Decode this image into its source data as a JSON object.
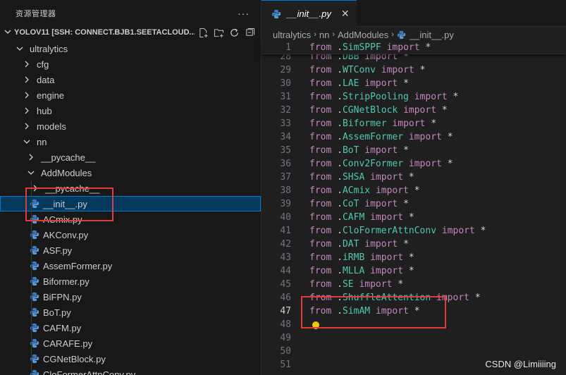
{
  "explorer": {
    "title": "资源管理器",
    "more": "···",
    "workspace": "YOLOV11 [SSH: CONNECT.BJB1.SEETACLOUD....",
    "actions": [
      "new-file-icon",
      "new-folder-icon",
      "refresh-icon",
      "collapse-all-icon"
    ],
    "tree": [
      {
        "label": "ultralytics",
        "depth": 0,
        "type": "folder-open"
      },
      {
        "label": "cfg",
        "depth": 1,
        "type": "folder"
      },
      {
        "label": "data",
        "depth": 1,
        "type": "folder"
      },
      {
        "label": "engine",
        "depth": 1,
        "type": "folder"
      },
      {
        "label": "hub",
        "depth": 1,
        "type": "folder"
      },
      {
        "label": "models",
        "depth": 1,
        "type": "folder"
      },
      {
        "label": "nn",
        "depth": 1,
        "type": "folder-open"
      },
      {
        "label": "__pycache__",
        "depth": 2,
        "type": "folder"
      },
      {
        "label": "AddModules",
        "depth": 2,
        "type": "folder-open"
      },
      {
        "label": "__pycache__",
        "depth": 3,
        "type": "folder"
      },
      {
        "label": "__init__.py",
        "depth": 3,
        "type": "file",
        "selected": true
      },
      {
        "label": "ACmix.py",
        "depth": 3,
        "type": "file"
      },
      {
        "label": "AKConv.py",
        "depth": 3,
        "type": "file"
      },
      {
        "label": "ASF.py",
        "depth": 3,
        "type": "file"
      },
      {
        "label": "AssemFormer.py",
        "depth": 3,
        "type": "file"
      },
      {
        "label": "Biformer.py",
        "depth": 3,
        "type": "file"
      },
      {
        "label": "BiFPN.py",
        "depth": 3,
        "type": "file"
      },
      {
        "label": "BoT.py",
        "depth": 3,
        "type": "file"
      },
      {
        "label": "CAFM.py",
        "depth": 3,
        "type": "file"
      },
      {
        "label": "CARAFE.py",
        "depth": 3,
        "type": "file"
      },
      {
        "label": "CGNetBlock.py",
        "depth": 3,
        "type": "file"
      },
      {
        "label": "CloFormerAttnConv.py",
        "depth": 3,
        "type": "file"
      }
    ]
  },
  "editor": {
    "tab": {
      "label": "__init__.py",
      "close": "✕"
    },
    "breadcrumb": [
      "ultralytics",
      "nn",
      "AddModules",
      "__init__.py"
    ],
    "sticky_line": {
      "num": "1",
      "module": "SimSPPF"
    },
    "lines": [
      {
        "num": "28",
        "module": "DBB"
      },
      {
        "num": "29",
        "module": "WTConv"
      },
      {
        "num": "30",
        "module": "LAE"
      },
      {
        "num": "31",
        "module": "StripPooling"
      },
      {
        "num": "32",
        "module": "CGNetBlock"
      },
      {
        "num": "33",
        "module": "Biformer"
      },
      {
        "num": "34",
        "module": "AssemFormer"
      },
      {
        "num": "35",
        "module": "BoT"
      },
      {
        "num": "36",
        "module": "Conv2Former"
      },
      {
        "num": "37",
        "module": "SHSA"
      },
      {
        "num": "38",
        "module": "ACmix"
      },
      {
        "num": "39",
        "module": "CoT"
      },
      {
        "num": "40",
        "module": "CAFM"
      },
      {
        "num": "41",
        "module": "CloFormerAttnConv"
      },
      {
        "num": "42",
        "module": "DAT"
      },
      {
        "num": "43",
        "module": "iRMB"
      },
      {
        "num": "44",
        "module": "MLLA"
      },
      {
        "num": "45",
        "module": "SE"
      },
      {
        "num": "46",
        "module": "ShuffleAttention"
      },
      {
        "num": "47",
        "module": "SimAM",
        "active": true
      },
      {
        "num": "48",
        "module": "",
        "bulb": true
      },
      {
        "num": "49",
        "module": ""
      },
      {
        "num": "50",
        "module": ""
      },
      {
        "num": "51",
        "module": ""
      }
    ],
    "keywords": {
      "from": "from",
      "import": "import",
      "dot": ".",
      "star": "*"
    }
  },
  "watermark": "CSDN @Limiiiing",
  "colors": {
    "annotation": "#e03c3c",
    "keyword": "#c586c0",
    "module": "#4ec9b0",
    "selection": "#04395e"
  }
}
